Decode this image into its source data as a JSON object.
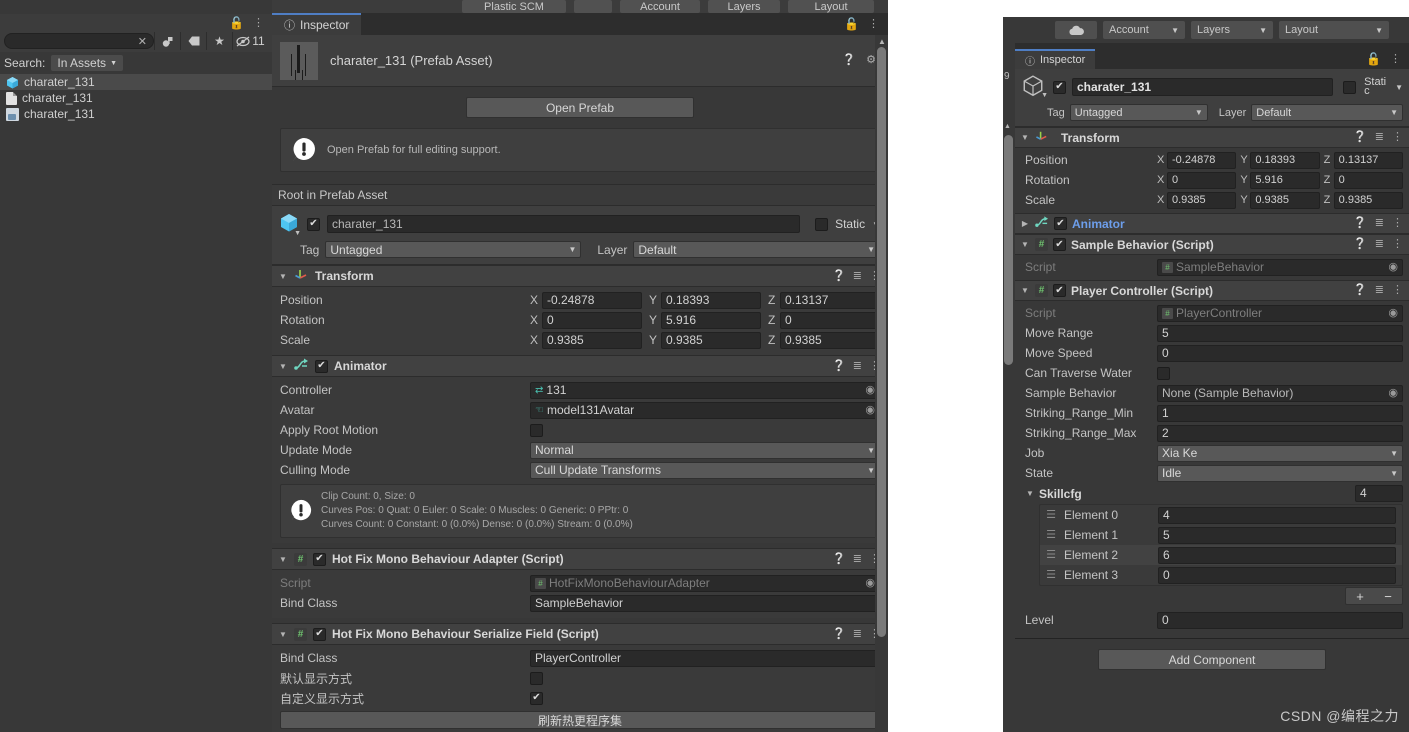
{
  "left_panel": {
    "search_placeholder": "",
    "search_label": "Search:",
    "search_scope": "In Assets",
    "clear_icon": "close-icon",
    "toolbar_icons": [
      "asset-filter-icon",
      "label-icon",
      "favorite-star-icon",
      "hidden-eye-icon"
    ],
    "hidden_count": "11",
    "lock_icon": "lock-open-icon",
    "menu_icon": "kebab-menu-icon",
    "assets": [
      {
        "name": "charater_131",
        "icon": "prefab-cube-icon",
        "selected": true
      },
      {
        "name": "charater_131",
        "icon": "text-document-icon",
        "selected": false
      },
      {
        "name": "charater_131",
        "icon": "meta-file-icon",
        "selected": false
      }
    ]
  },
  "top_strip": {
    "buttons": [
      "Plastic SCM",
      "",
      "Account",
      "Layers",
      "Layout"
    ]
  },
  "inspector": {
    "tab_label": "Inspector",
    "tab_icon": "info-icon",
    "lock_icon": "lock-open-icon",
    "menu_icon": "kebab-menu-icon",
    "asset_title": "charater_131 (Prefab Asset)",
    "help_icon": "help-icon",
    "settings_icon": "gear-icon",
    "open_prefab_button": "Open Prefab",
    "prefab_hint": "Open Prefab for full editing support.",
    "root_bar": "Root in Prefab Asset",
    "game_object": {
      "enabled": true,
      "name": "charater_131",
      "static_checked": false,
      "static_label": "Static",
      "tag_label": "Tag",
      "tag_value": "Untagged",
      "layer_label": "Layer",
      "layer_value": "Default"
    },
    "components": [
      {
        "title": "Transform",
        "icon": "transform-axis-icon",
        "expanded": true,
        "has_checkbox": false,
        "rows": [
          {
            "label": "Position",
            "type": "vec3",
            "x": "-0.24878",
            "y": "0.18393",
            "z": "0.13137"
          },
          {
            "label": "Rotation",
            "type": "vec3",
            "x": "0",
            "y": "5.916",
            "z": "0"
          },
          {
            "label": "Scale",
            "type": "vec3",
            "x": "0.9385",
            "y": "0.9385",
            "z": "0.9385"
          }
        ]
      },
      {
        "title": "Animator",
        "icon": "animator-icon",
        "expanded": true,
        "has_checkbox": true,
        "checked": true,
        "rows": [
          {
            "label": "Controller",
            "type": "object",
            "value": "131",
            "icon": "animator-controller-icon"
          },
          {
            "label": "Avatar",
            "type": "object",
            "value": "model131Avatar",
            "icon": "avatar-icon"
          },
          {
            "label": "Apply Root Motion",
            "type": "checkbox",
            "checked": false
          },
          {
            "label": "Update Mode",
            "type": "dropdown",
            "value": "Normal"
          },
          {
            "label": "Culling Mode",
            "type": "dropdown",
            "value": "Cull Update Transforms"
          }
        ],
        "info_lines": [
          "Clip Count: 0, Size: 0",
          "Curves Pos: 0 Quat: 0 Euler: 0 Scale: 0 Muscles: 0 Generic: 0 PPtr: 0",
          "Curves Count: 0 Constant: 0 (0.0%) Dense: 0 (0.0%) Stream: 0 (0.0%)"
        ]
      },
      {
        "title": "Hot Fix Mono Behaviour Adapter (Script)",
        "icon": "script-hash-icon",
        "expanded": true,
        "has_checkbox": true,
        "checked": true,
        "rows": [
          {
            "label": "Script",
            "type": "object-ro",
            "value": "HotFixMonoBehaviourAdapter"
          },
          {
            "label": "Bind Class",
            "type": "text",
            "value": "SampleBehavior"
          }
        ]
      },
      {
        "title": "Hot Fix Mono Behaviour Serialize Field (Script)",
        "icon": "script-hash-icon",
        "expanded": true,
        "has_checkbox": true,
        "checked": true,
        "rows": [
          {
            "label": "Bind Class",
            "type": "text",
            "value": "PlayerController"
          },
          {
            "label": "默认显示方式",
            "type": "checkbox",
            "checked": false
          },
          {
            "label": "自定义显示方式",
            "type": "checkbox",
            "checked": true
          }
        ],
        "footer_button": "刷新热更程序集"
      }
    ]
  },
  "right_inspector": {
    "toolbar": {
      "cloud_icon": "cloud-icon",
      "account": "Account",
      "layers": "Layers",
      "layout": "Layout"
    },
    "tab_label": "Inspector",
    "tab_icon": "info-icon",
    "lock_icon": "lock-open-icon",
    "menu_icon": "kebab-menu-icon",
    "game_object": {
      "enabled": true,
      "name": "charater_131",
      "static_checked": false,
      "static_label": "Stati",
      "static_label_2": "c",
      "tag_label": "Tag",
      "tag_value": "Untagged",
      "layer_label": "Layer",
      "layer_value": "Default"
    },
    "components": [
      {
        "title": "Transform",
        "icon": "transform-axis-icon",
        "expanded": true,
        "has_checkbox": false,
        "rows": [
          {
            "label": "Position",
            "type": "vec3",
            "x": "-0.24878",
            "y": "0.18393",
            "z": "0.13137"
          },
          {
            "label": "Rotation",
            "type": "vec3",
            "x": "0",
            "y": "5.916",
            "z": "0"
          },
          {
            "label": "Scale",
            "type": "vec3",
            "x": "0.9385",
            "y": "0.9385",
            "z": "0.9385"
          }
        ]
      },
      {
        "title": "Animator",
        "icon": "animator-icon",
        "expanded": false,
        "highlighted": true,
        "has_checkbox": true,
        "checked": true,
        "rows": []
      },
      {
        "title": "Sample Behavior (Script)",
        "icon": "script-hash-icon",
        "expanded": true,
        "has_checkbox": true,
        "checked": true,
        "rows": [
          {
            "label": "Script",
            "type": "object-ro",
            "value": "SampleBehavior"
          }
        ]
      },
      {
        "title": "Player Controller (Script)",
        "icon": "script-hash-icon",
        "expanded": true,
        "has_checkbox": true,
        "checked": true,
        "rows": [
          {
            "label": "Script",
            "type": "object-ro",
            "value": "PlayerController"
          },
          {
            "label": "Move Range",
            "type": "text",
            "value": "5"
          },
          {
            "label": "Move Speed",
            "type": "text",
            "value": "0"
          },
          {
            "label": "Can Traverse Water",
            "type": "checkbox",
            "checked": false
          },
          {
            "label": "Sample Behavior",
            "type": "object",
            "value": "None (Sample Behavior)"
          },
          {
            "label": "Striking_Range_Min",
            "type": "text",
            "value": "1"
          },
          {
            "label": "Striking_Range_Max",
            "type": "text",
            "value": "2"
          },
          {
            "label": "Job",
            "type": "dropdown",
            "value": "Xia Ke"
          },
          {
            "label": "State",
            "type": "dropdown",
            "value": "Idle"
          }
        ],
        "array": {
          "label": "Skillcfg",
          "size": "4",
          "elements": [
            {
              "label": "Element 0",
              "value": "4"
            },
            {
              "label": "Element 1",
              "value": "5"
            },
            {
              "label": "Element 2",
              "value": "6"
            },
            {
              "label": "Element 3",
              "value": "0"
            }
          ],
          "add_button": "+",
          "remove_button": "−"
        },
        "tail_rows": [
          {
            "label": "Level",
            "type": "text",
            "value": "0"
          }
        ]
      }
    ],
    "add_component_button": "Add Component"
  },
  "watermark": "CSDN @编程之力",
  "colors": {
    "panel_bg": "#383838",
    "header_bg": "#414141",
    "field_bg": "#2a2a2a",
    "dropdown_bg": "#585858",
    "accent_blue": "#4f7ec4",
    "link_blue": "#6d9eeb",
    "text": "#c4c4c4"
  }
}
